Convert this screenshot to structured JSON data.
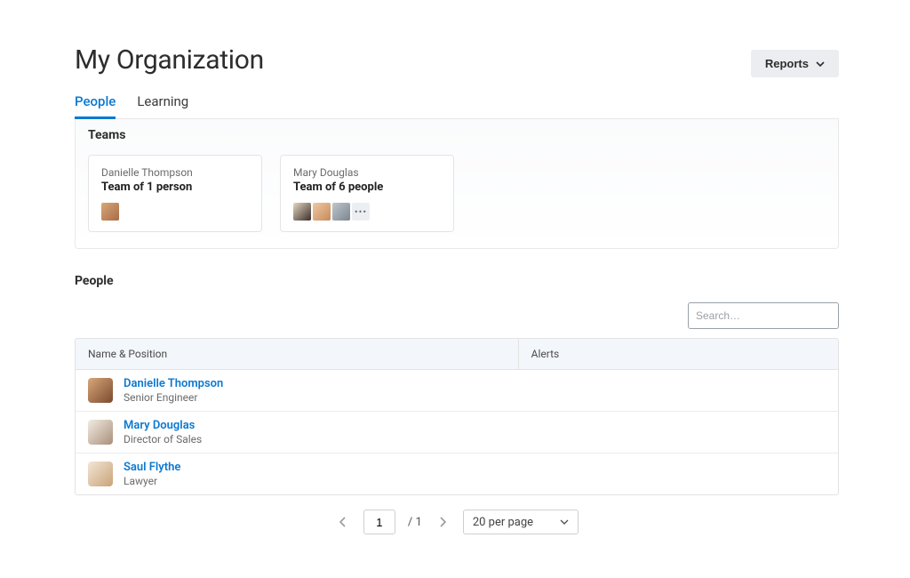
{
  "header": {
    "title": "My Organization",
    "reports_label": "Reports"
  },
  "tabs": {
    "people": "People",
    "learning": "Learning"
  },
  "teams_section": {
    "heading": "Teams",
    "cards": [
      {
        "owner": "Danielle Thompson",
        "size_label": "Team of 1 person"
      },
      {
        "owner": "Mary Douglas",
        "size_label": "Team of 6 people"
      }
    ],
    "more_indicator": "•••"
  },
  "people_section": {
    "heading": "People",
    "search_placeholder": "Search…",
    "columns": {
      "name": "Name & Position",
      "alerts": "Alerts"
    },
    "rows": [
      {
        "name": "Danielle Thompson",
        "position": "Senior Engineer"
      },
      {
        "name": "Mary Douglas",
        "position": "Director of Sales"
      },
      {
        "name": "Saul Flythe",
        "position": "Lawyer"
      }
    ]
  },
  "pagination": {
    "current": "1",
    "total_label": "/ 1",
    "per_page_label": "20 per page"
  }
}
